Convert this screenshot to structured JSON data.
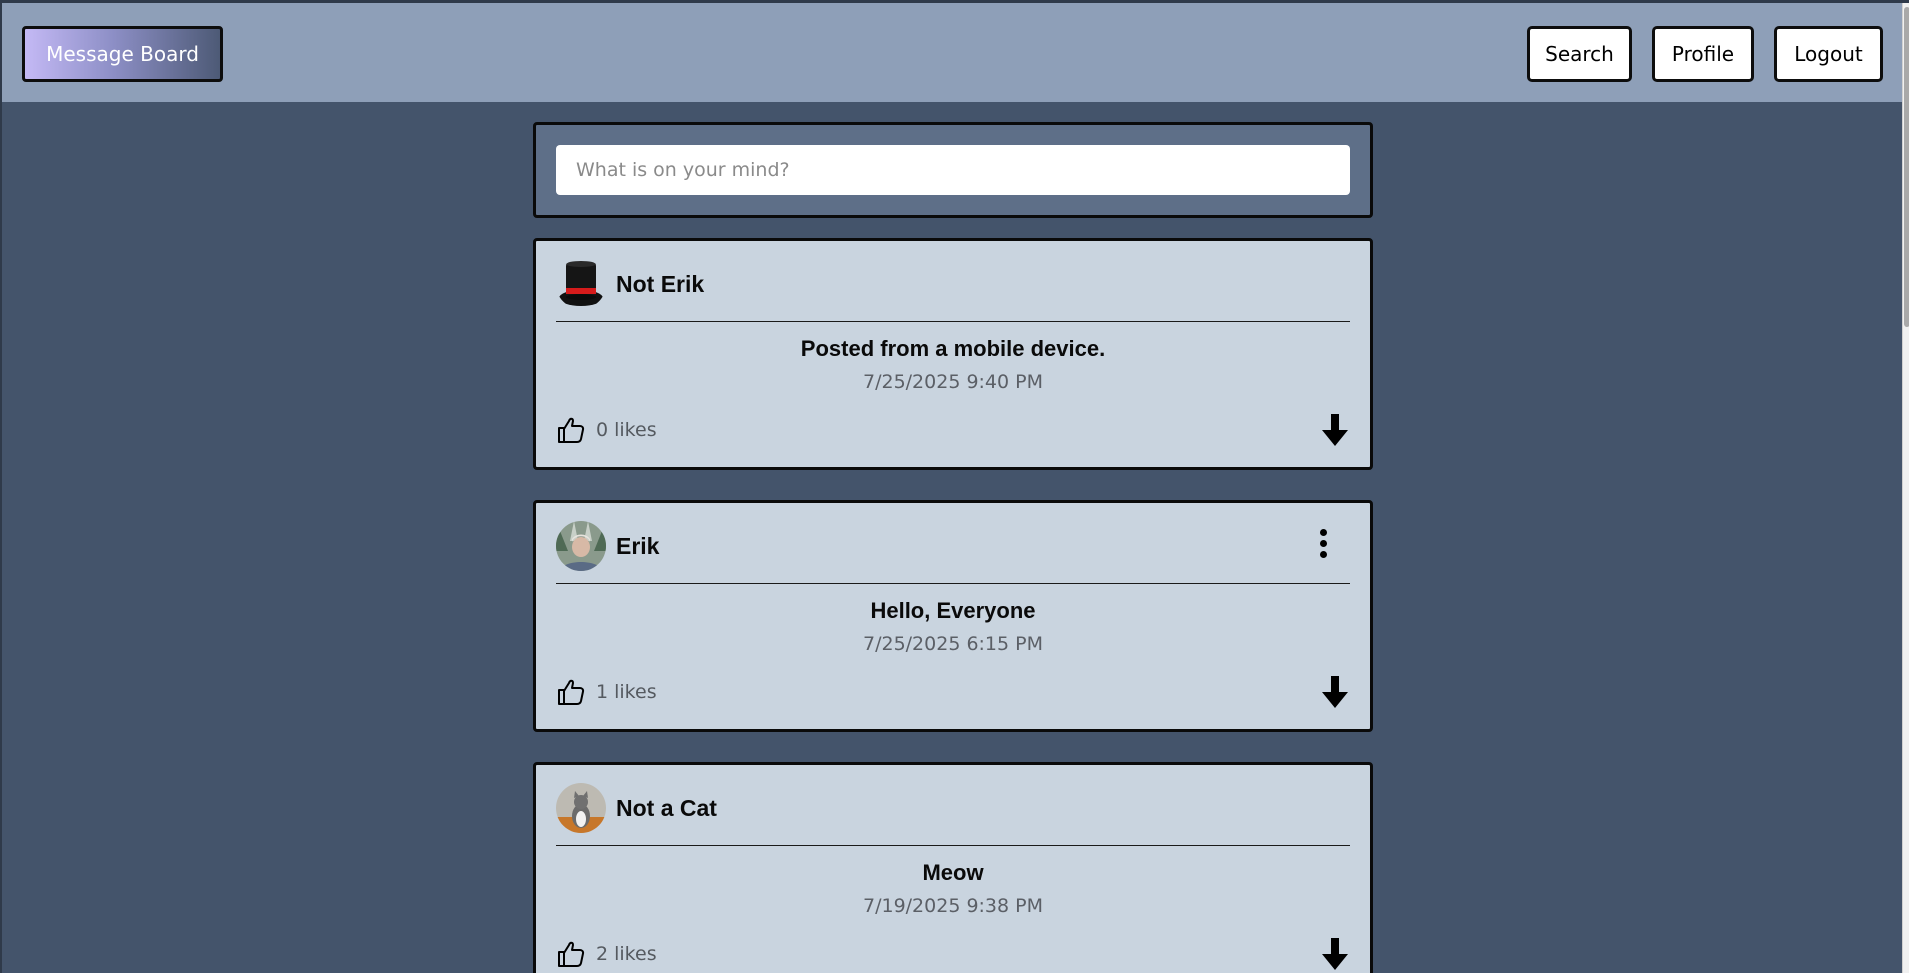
{
  "header": {
    "brand": "Message Board",
    "nav": {
      "search": "Search",
      "profile": "Profile",
      "logout": "Logout"
    }
  },
  "composer": {
    "placeholder": "What is on your mind?",
    "value": ""
  },
  "posts": [
    {
      "author": "Not Erik",
      "avatar": "top-hat",
      "title": "Posted from a mobile device.",
      "time": "7/25/2025 9:40 PM",
      "likes": "0 likes",
      "has_menu": false
    },
    {
      "author": "Erik",
      "avatar": "person-photo",
      "title": "Hello, Everyone",
      "time": "7/25/2025 6:15 PM",
      "likes": "1 likes",
      "has_menu": true
    },
    {
      "author": "Not a Cat",
      "avatar": "cat-photo",
      "title": "Meow",
      "time": "7/19/2025 9:38 PM",
      "likes": "2 likes",
      "has_menu": false
    }
  ],
  "colors": {
    "page_bg": "#44546b",
    "header_bg": "#8e9fb8",
    "post_bg": "#c9d4df",
    "composer_bg": "#5e6f88"
  }
}
